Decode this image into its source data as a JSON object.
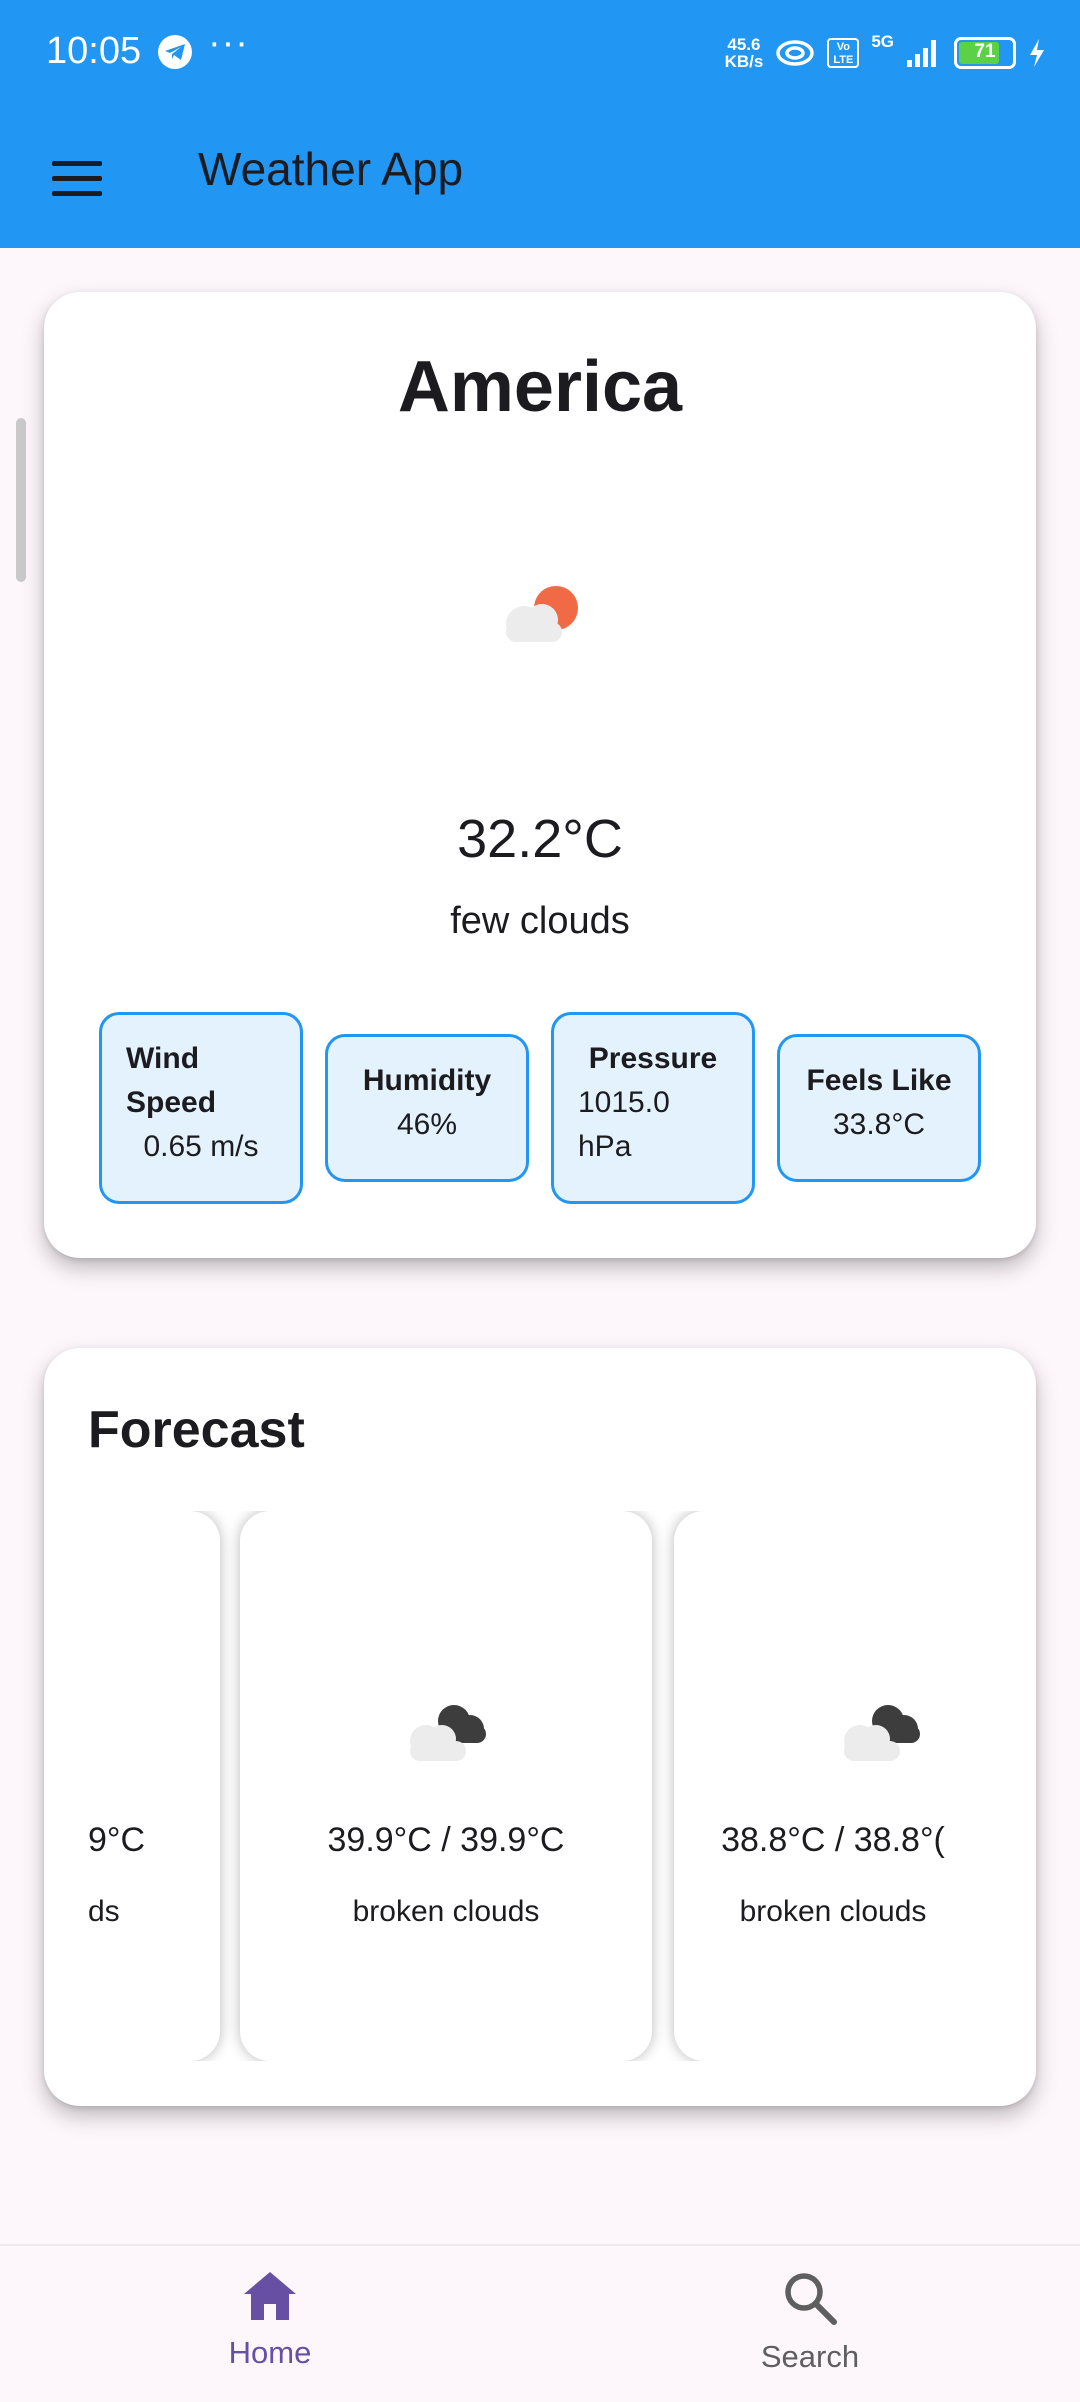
{
  "status_bar": {
    "time": "10:05",
    "more": "···",
    "net_speed_value": "45.6",
    "net_speed_unit": "KB/s",
    "network": "5G",
    "volte": "Vo LTE",
    "battery": "71"
  },
  "app_bar": {
    "title": "Weather App",
    "menu_icon": "hamburger-menu-icon"
  },
  "current": {
    "city": "America",
    "icon": "few-clouds-icon",
    "temperature": "32.2°C",
    "description": "few clouds",
    "stats": [
      {
        "label": "Wind Speed",
        "value": "0.65 m/s"
      },
      {
        "label": "Humidity",
        "value": "46%"
      },
      {
        "label": "Pressure",
        "value": "1015.0 hPa"
      },
      {
        "label": "Feels Like",
        "value": "33.8°C"
      }
    ]
  },
  "forecast": {
    "title": "Forecast",
    "items": [
      {
        "temp": "9°C",
        "description": "ds",
        "icon": "broken-clouds-icon"
      },
      {
        "temp": "39.9°C / 39.9°C",
        "description": "broken clouds",
        "icon": "broken-clouds-icon"
      },
      {
        "temp": "38.8°C / 38.8°(",
        "description": "broken clouds",
        "icon": "broken-clouds-icon"
      }
    ]
  },
  "bottom_nav": {
    "home_label": "Home",
    "search_label": "Search"
  },
  "colors": {
    "primary": "#2196f3",
    "nav_active": "#6750a4",
    "stat_bg": "#e3f2fd"
  }
}
